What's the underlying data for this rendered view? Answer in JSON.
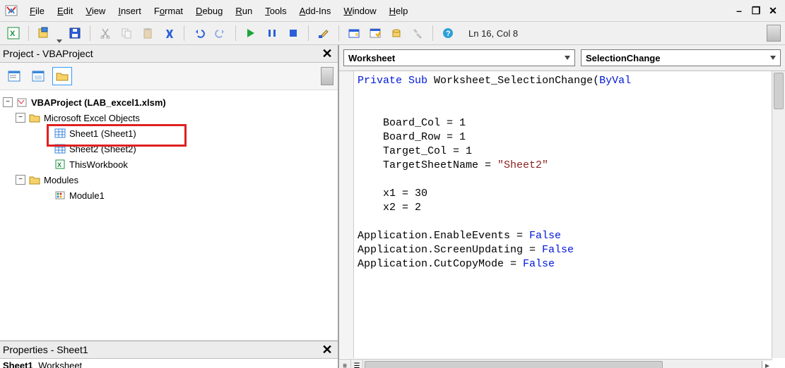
{
  "menubar": {
    "items": [
      {
        "pre": "",
        "u": "F",
        "post": "ile"
      },
      {
        "pre": "",
        "u": "E",
        "post": "dit"
      },
      {
        "pre": "",
        "u": "V",
        "post": "iew"
      },
      {
        "pre": "",
        "u": "I",
        "post": "nsert"
      },
      {
        "pre": "F",
        "u": "o",
        "post": "rmat"
      },
      {
        "pre": "",
        "u": "D",
        "post": "ebug"
      },
      {
        "pre": "",
        "u": "R",
        "post": "un"
      },
      {
        "pre": "",
        "u": "T",
        "post": "ools"
      },
      {
        "pre": "",
        "u": "A",
        "post": "dd-Ins"
      },
      {
        "pre": "",
        "u": "W",
        "post": "indow"
      },
      {
        "pre": "",
        "u": "H",
        "post": "elp"
      }
    ]
  },
  "toolbar": {
    "location": "Ln 16, Col 8"
  },
  "project_panel": {
    "title": "Project - VBAProject",
    "root": "VBAProject (LAB_excel1.xlsm)",
    "excel_objects": "Microsoft Excel Objects",
    "sheet1": "Sheet1 (Sheet1)",
    "sheet2": "Sheet2 (Sheet2)",
    "thisworkbook": "ThisWorkbook",
    "modules": "Modules",
    "module1": "Module1"
  },
  "properties_panel": {
    "title": "Properties - Sheet1",
    "object_name": "Sheet1",
    "object_type": "Worksheet"
  },
  "dropdowns": {
    "object": "Worksheet",
    "procedure": "SelectionChange"
  },
  "code": {
    "l1a": "Private",
    "l1b": "Sub",
    "l1c": " Worksheet_SelectionChange(",
    "l1d": "ByVal",
    "l3": "    Board_Col = 1",
    "l4": "    Board_Row = 1",
    "l5": "    Target_Col = 1",
    "l6a": "    TargetSheetName = ",
    "l6b": "\"Sheet2\"",
    "l8": "    x1 = 30",
    "l9": "    x2 = 2",
    "l11a": "Application.EnableEvents = ",
    "l11b": "False",
    "l12a": "Application.ScreenUpdating = ",
    "l12b": "False",
    "l13a": "Application.CutCopyMode = ",
    "l13b": "False"
  }
}
